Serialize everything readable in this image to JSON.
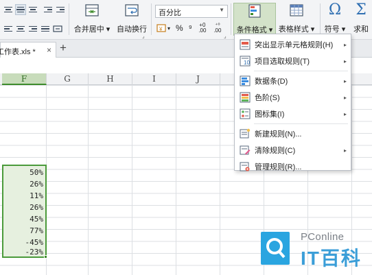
{
  "ribbon": {
    "merge_center_label": "合并居中",
    "wrap_text_label": "自动换行",
    "number_format_value": "百分比",
    "percent_symbol": "%",
    "thousands_symbol": "⁹",
    "decimal_increase": "+0 .00",
    "decimal_decrease": "⁺⁰ .00",
    "conditional_format_label": "条件格式",
    "table_style_label": "表格样式",
    "symbol_label": "符号",
    "sum_label": "求和"
  },
  "tabs": {
    "file_tab_label": "工作表.xls *",
    "close_glyph": "×",
    "new_tab_glyph": "+"
  },
  "sheet": {
    "columns": [
      "F",
      "G",
      "H",
      "I",
      "J"
    ],
    "selected_column": "F",
    "values": [
      "50%",
      "26%",
      "11%",
      "26%",
      "45%",
      "77%",
      "-45%",
      "-23%"
    ]
  },
  "menu": {
    "items": [
      {
        "label": "突出显示单元格规则(H)",
        "icon": "highlight-rules-icon",
        "has_submenu": true
      },
      {
        "label": "项目选取规则(T)",
        "icon": "top-bottom-rules-icon",
        "has_submenu": true
      },
      {
        "label": "数据条(D)",
        "icon": "data-bars-icon",
        "has_submenu": true
      },
      {
        "label": "色阶(S)",
        "icon": "color-scales-icon",
        "has_submenu": true
      },
      {
        "label": "图标集(I)",
        "icon": "icon-sets-icon",
        "has_submenu": true
      },
      {
        "label": "新建规则(N)...",
        "icon": "new-rule-icon",
        "has_submenu": false
      },
      {
        "label": "清除规则(C)",
        "icon": "clear-rules-icon",
        "has_submenu": true
      },
      {
        "label": "管理规则(R)...",
        "icon": "manage-rules-icon",
        "has_submenu": false
      }
    ]
  },
  "watermark": {
    "line1": "PConline",
    "line2": "IT百科"
  },
  "colors": {
    "accent_green": "#4a9a3a",
    "selection_fill": "#e6f0df",
    "active_button": "#d3e2c9",
    "watermark_blue": "#2aa5e0"
  }
}
